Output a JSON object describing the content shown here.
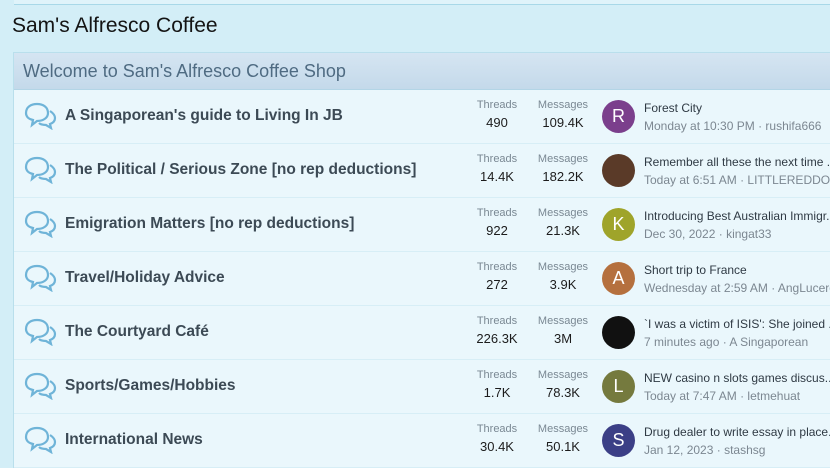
{
  "page": {
    "title": "Sam's Alfresco Coffee"
  },
  "block": {
    "header": "Welcome to Sam's Alfresco Coffee Shop"
  },
  "labels": {
    "threads": "Threads",
    "messages": "Messages"
  },
  "nodes": [
    {
      "title": "A Singaporean's guide to Living In JB",
      "threads": "490",
      "messages": "109.4K",
      "avatar": {
        "letter": "R",
        "color": "#7b3f8c"
      },
      "latest_title": "Forest City",
      "latest_time": "Monday at 10:30 PM",
      "latest_user": "rushifa666"
    },
    {
      "title": "The Political / Serious Zone [no rep deductions]",
      "threads": "14.4K",
      "messages": "182.2K",
      "avatar": {
        "letter": "",
        "color": "#5a3a28"
      },
      "latest_title": "Remember all these the next time ...",
      "latest_time": "Today at 6:51 AM",
      "latest_user": "LITTLEREDDOT"
    },
    {
      "title": "Emigration Matters [no rep deductions]",
      "threads": "922",
      "messages": "21.3K",
      "avatar": {
        "letter": "K",
        "color": "#9fa42a"
      },
      "latest_title": "Introducing Best Australian Immigr...",
      "latest_time": "Dec 30, 2022",
      "latest_user": "kingat33"
    },
    {
      "title": "Travel/Holiday Advice",
      "threads": "272",
      "messages": "3.9K",
      "avatar": {
        "letter": "A",
        "color": "#b5703e"
      },
      "latest_title": "Short trip to France",
      "latest_time": "Wednesday at 2:59 AM",
      "latest_user": "AngLucero"
    },
    {
      "title": "The Courtyard Café",
      "threads": "226.3K",
      "messages": "3M",
      "avatar": {
        "letter": "",
        "color": "#111111"
      },
      "latest_title": "`I was a victim of ISIS': She joined ...",
      "latest_time": "7 minutes ago",
      "latest_user": "A Singaporean"
    },
    {
      "title": "Sports/Games/Hobbies",
      "threads": "1.7K",
      "messages": "78.3K",
      "avatar": {
        "letter": "L",
        "color": "#757a3e"
      },
      "latest_title": "NEW casino n slots games discus...",
      "latest_time": "Today at 7:47 AM",
      "latest_user": "letmehuat"
    },
    {
      "title": "International News",
      "threads": "30.4K",
      "messages": "50.1K",
      "avatar": {
        "letter": "S",
        "color": "#3b3f86"
      },
      "latest_title": "Drug dealer to write essay in place...",
      "latest_time": "Jan 12, 2023",
      "latest_user": "stashsg"
    }
  ],
  "icons": {
    "node": "speech-bubbles-icon"
  },
  "colors": {
    "accent": "#4f6b82",
    "icon": "#6fb4d8"
  }
}
